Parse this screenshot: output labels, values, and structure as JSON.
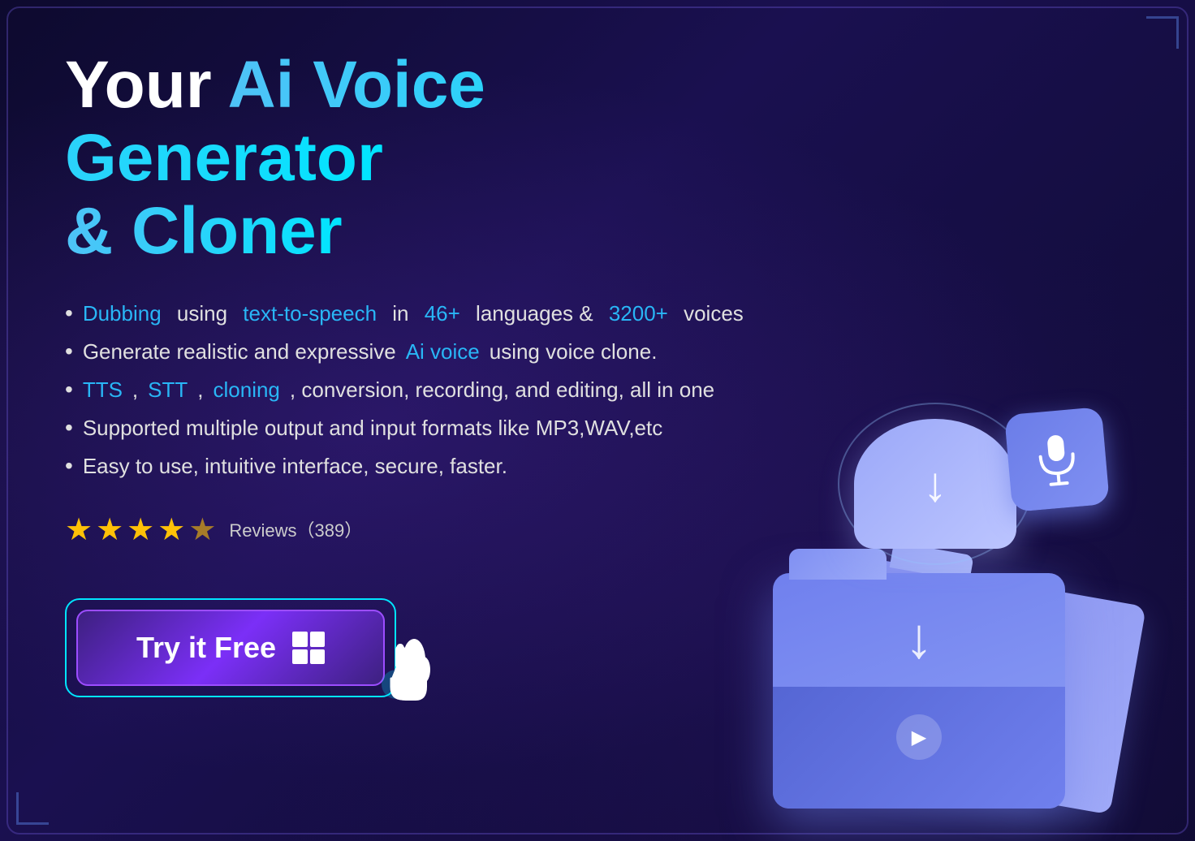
{
  "headline": {
    "white_part": "Your ",
    "blue_part": "Ai Voice Generator",
    "line2": "& Cloner"
  },
  "features": [
    {
      "parts": [
        {
          "text": "Dubbing",
          "style": "blue"
        },
        {
          "text": " using ",
          "style": "normal"
        },
        {
          "text": "text-to-speech",
          "style": "blue"
        },
        {
          "text": " in ",
          "style": "normal"
        },
        {
          "text": "46+",
          "style": "blue"
        },
        {
          "text": " languages & ",
          "style": "normal"
        },
        {
          "text": "3200+",
          "style": "blue"
        },
        {
          "text": " voices",
          "style": "normal"
        }
      ]
    },
    {
      "parts": [
        {
          "text": "Generate realistic and expressive ",
          "style": "normal"
        },
        {
          "text": "Ai voice",
          "style": "blue"
        },
        {
          "text": " using voice clone.",
          "style": "normal"
        }
      ]
    },
    {
      "parts": [
        {
          "text": "TTS",
          "style": "blue"
        },
        {
          "text": ", ",
          "style": "normal"
        },
        {
          "text": "STT",
          "style": "blue"
        },
        {
          "text": ", ",
          "style": "normal"
        },
        {
          "text": "cloning",
          "style": "blue"
        },
        {
          "text": ", conversion, recording, and editing, all in one",
          "style": "normal"
        }
      ]
    },
    {
      "parts": [
        {
          "text": "Supported multiple output and input formats like MP3,WAV,etc",
          "style": "normal"
        }
      ]
    },
    {
      "parts": [
        {
          "text": "Easy to use, intuitive interface, secure, faster.",
          "style": "normal"
        }
      ]
    }
  ],
  "rating": {
    "stars_full": 4,
    "stars_half": 1,
    "reviews_text": "Reviews（389）"
  },
  "cta_button": {
    "label": "Try it Free",
    "icon": "windows"
  },
  "colors": {
    "background": "#0d0a2e",
    "accent_blue": "#29b6f6",
    "accent_cyan": "#00e5ff",
    "star_color": "#ffc107",
    "button_border": "#9c4dff",
    "outer_border": "#00e5ff"
  }
}
